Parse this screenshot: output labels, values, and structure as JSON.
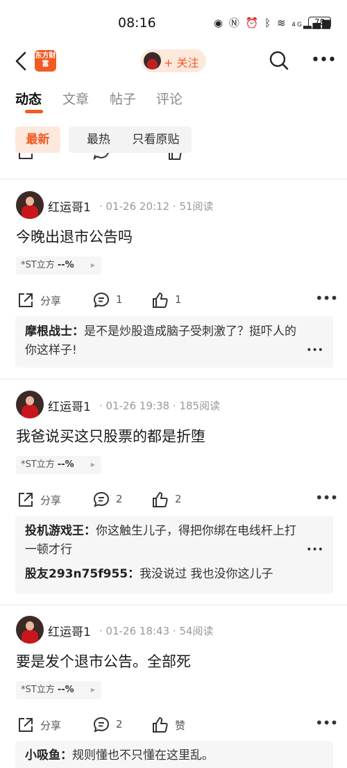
{
  "status_bar": {
    "time": "08:16",
    "signal_label": "4G",
    "battery": "78"
  },
  "nav": {
    "logo_text": "东方财富",
    "follow_label": "+ 关注"
  },
  "tabs": [
    {
      "label": "动态",
      "active": true
    },
    {
      "label": "文章",
      "active": false
    },
    {
      "label": "帖子",
      "active": false
    },
    {
      "label": "评论",
      "active": false
    }
  ],
  "filters": [
    {
      "label": "最新",
      "active": true
    },
    {
      "label": "最热",
      "active": false
    },
    {
      "label": "只看原贴",
      "active": false
    }
  ],
  "posts": [
    {
      "author": "红运哥1",
      "time": "01-26 20:12",
      "reads": "51阅读",
      "title": "今晚出退市公告吗",
      "stock": "*ST立方",
      "change": "--%",
      "share_label": "分享",
      "comment_count": "1",
      "like_count": "1",
      "comments": [
        {
          "name": "摩根战士",
          "text": "是不是炒股造成脑子受刺激了？挺吓人的你这样子!"
        }
      ]
    },
    {
      "author": "红运哥1",
      "time": "01-26 19:38",
      "reads": "185阅读",
      "title": "我爸说买这只股票的都是折堕",
      "stock": "*ST立方",
      "change": "--%",
      "share_label": "分享",
      "comment_count": "2",
      "like_count": "2",
      "comments": [
        {
          "name": "投机游戏王",
          "text": "你这触生儿子，得把你绑在电线杆上打一顿才行"
        },
        {
          "name": "股友293n75f955",
          "text": "我没说过 我也没你这儿子"
        }
      ]
    },
    {
      "author": "红运哥1",
      "time": "01-26 18:43",
      "reads": "54阅读",
      "title": "要是发个退市公告。全部死",
      "stock": "*ST立方",
      "change": "--%",
      "share_label": "分享",
      "comment_count": "2",
      "like_count": "赞",
      "comments": [
        {
          "name": "小吸鱼",
          "text": "规则懂也不只懂在这里乱。"
        }
      ]
    }
  ]
}
